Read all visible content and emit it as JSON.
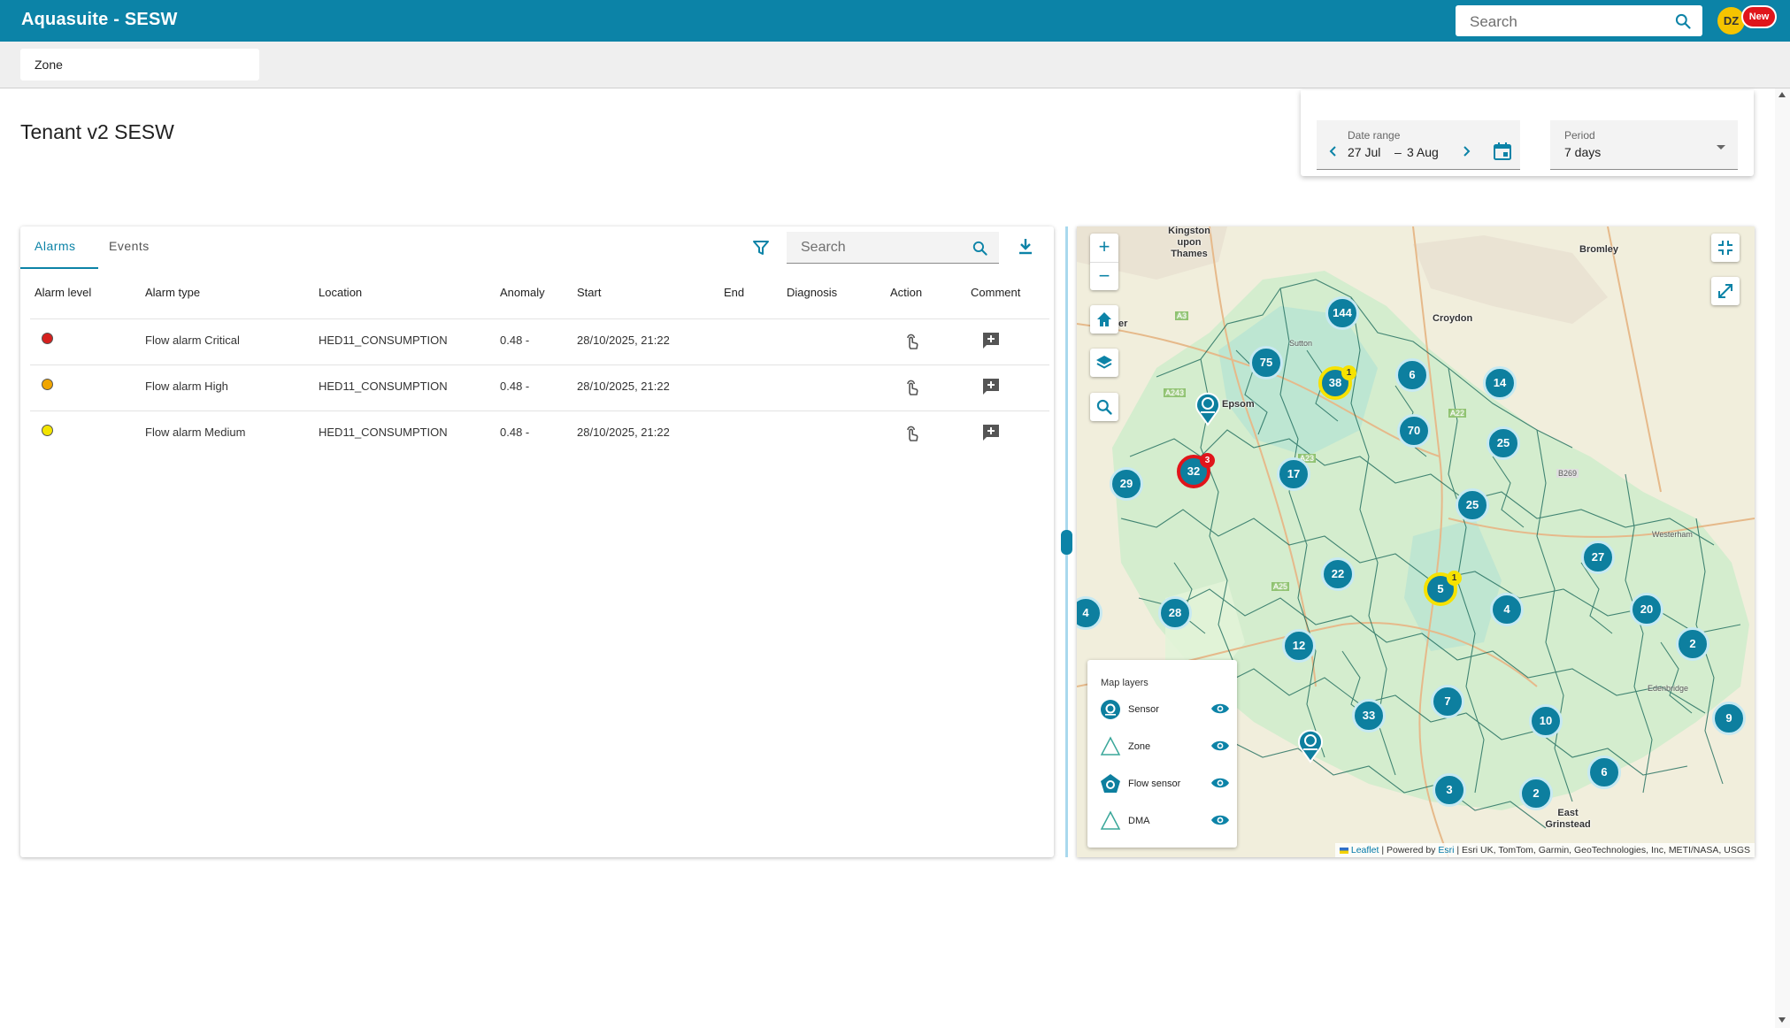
{
  "app": {
    "title": "Aquasuite",
    "separator": "-",
    "tenant": "SESW"
  },
  "top_search": {
    "placeholder": "Search"
  },
  "user": {
    "initials": "DZ",
    "new_badge": "New"
  },
  "breadcrumb": {
    "zone_label": "Zone"
  },
  "page": {
    "title": "Tenant v2 SESW"
  },
  "date_range": {
    "label": "Date range",
    "start": "27 Jul",
    "dash": "–",
    "end": "3 Aug"
  },
  "period": {
    "label": "Period",
    "value": "7 days"
  },
  "tabs": [
    {
      "label": "Alarms",
      "active": true
    },
    {
      "label": "Events",
      "active": false
    }
  ],
  "table_search": {
    "placeholder": "Search"
  },
  "table": {
    "columns": [
      "Alarm level",
      "Alarm type",
      "Location",
      "Anomaly",
      "Start",
      "End",
      "Diagnosis",
      "Action",
      "Comment"
    ],
    "rows": [
      {
        "level_color": "#d6201e",
        "type": "Flow alarm Critical",
        "location": "HED11_CONSUMPTION",
        "anomaly": "0.48 -",
        "start": "28/10/2025, 21:22",
        "end": "",
        "diagnosis": ""
      },
      {
        "level_color": "#f0a500",
        "type": "Flow alarm High",
        "location": "HED11_CONSUMPTION",
        "anomaly": "0.48 -",
        "start": "28/10/2025, 21:22",
        "end": "",
        "diagnosis": ""
      },
      {
        "level_color": "#f3e400",
        "type": "Flow alarm Medium",
        "location": "HED11_CONSUMPTION",
        "anomaly": "0.48 -",
        "start": "28/10/2025, 21:22",
        "end": "",
        "diagnosis": ""
      }
    ]
  },
  "map": {
    "labels": {
      "kingston": "Kingston upon Thames",
      "bromley": "Bromley",
      "croydon": "Croydon",
      "epsom": "Epsom",
      "east_grinstead": "East Grinstead",
      "westerham": "Westerham",
      "edenbridge": "Edenbridge",
      "sutton": "Sutton",
      "ier": "ier"
    },
    "road_labels": {
      "a3": "A3",
      "a243": "A243",
      "a23": "A23",
      "a22": "A22",
      "b269": "B269",
      "a25": "A25"
    },
    "clusters": [
      "144",
      "75",
      "38",
      "6",
      "14",
      "70",
      "25",
      "17",
      "32",
      "29",
      "25",
      "27",
      "22",
      "5",
      "4",
      "20",
      "2",
      "4",
      "28",
      "12",
      "7",
      "33",
      "10",
      "9",
      "3",
      "2",
      "6"
    ],
    "cluster_badges": {
      "38": "1",
      "32": "3",
      "5": "1"
    },
    "attribution": {
      "leaflet": "Leaflet",
      "powered": "| Powered by",
      "esri": "Esri",
      "rest": "| Esri UK, TomTom, Garmin, GeoTechnologies, Inc, METI/NASA, USGS"
    },
    "layers": {
      "title": "Map layers",
      "items": [
        {
          "label": "Sensor"
        },
        {
          "label": "Zone"
        },
        {
          "label": "Flow sensor"
        },
        {
          "label": "DMA"
        }
      ]
    }
  },
  "colors": {
    "primary": "#0c83a7",
    "cluster": "#0d7f9f",
    "critical": "#d6201e",
    "high": "#f0a500",
    "medium": "#f3e400"
  }
}
